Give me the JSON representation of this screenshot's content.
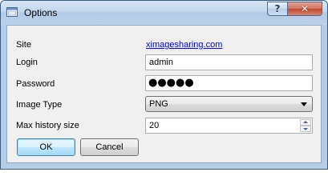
{
  "window": {
    "title": "Options",
    "help_button": "?",
    "close_button": "✕"
  },
  "form": {
    "site": {
      "label": "Site",
      "link_text": "ximagesharing.com"
    },
    "login": {
      "label": "Login",
      "value": "admin"
    },
    "password": {
      "label": "Password",
      "masked_value": "●●●●●"
    },
    "image_type": {
      "label": "Image Type",
      "selected": "PNG"
    },
    "max_history": {
      "label": "Max history size",
      "value": "20"
    }
  },
  "buttons": {
    "ok": "OK",
    "cancel": "Cancel"
  },
  "colors": {
    "link": "#0000ee",
    "focus_border": "#3c7fb1",
    "close_red": "#c34a32"
  }
}
